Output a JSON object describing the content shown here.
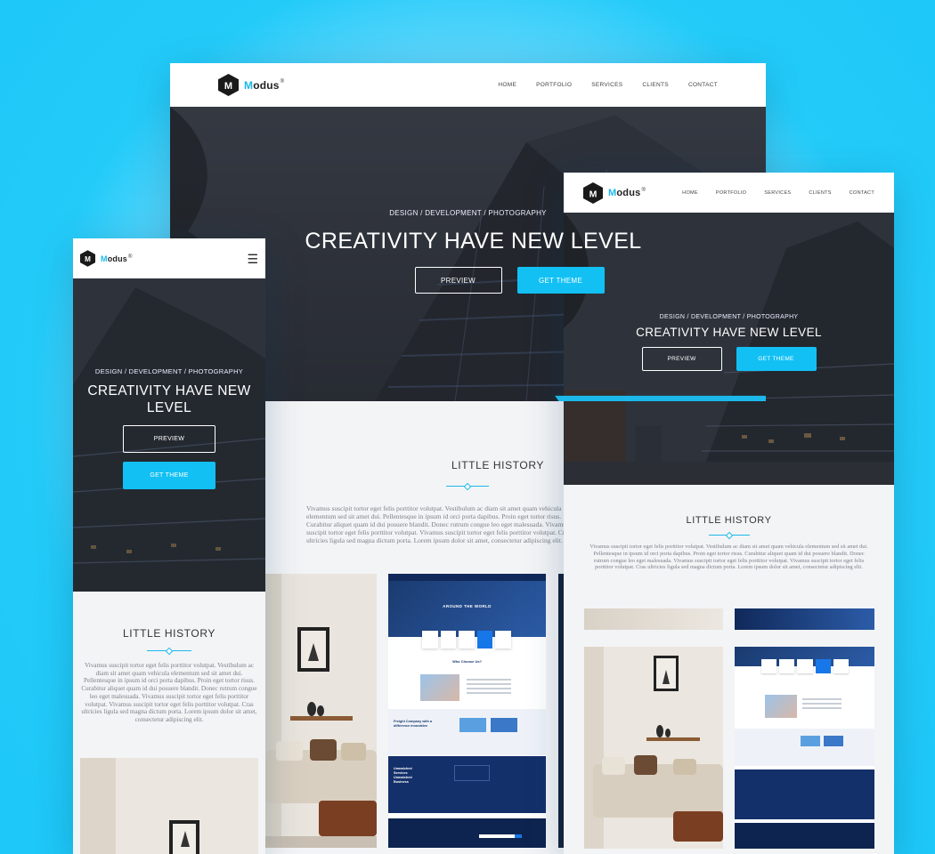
{
  "brand": {
    "name_first": "M",
    "name_rest": "odus",
    "mark": "®",
    "monogram": "M"
  },
  "nav": {
    "items": [
      "HOME",
      "PORTFOLIO",
      "SERVICES",
      "CLIENTS",
      "CONTACT"
    ],
    "menu_icon": "hamburger-icon"
  },
  "hero": {
    "eyebrow": "DESIGN / DEVELOPMENT / PHOTOGRAPHY",
    "headline": "CREATIVITY HAVE NEW LEVEL",
    "headline_mobile_line1": "CREATIVITY HAVE NEW",
    "headline_mobile_line2": "LEVEL",
    "preview_label": "PREVIEW",
    "get_theme_label": "GET THEME",
    "scroll_icon": "chevron-down-icon"
  },
  "history": {
    "title": "LITTLE HISTORY",
    "body": "Vivamus suscipit tortor eget felis porttitor volutpat. Vestibulum ac diam sit amet quam vehicula elementum sed sit amet dui. Pellentesque in ipsum id orci porta dapibus. Proin eget tortor risus. Curabitur aliquet quam id dui posuere blandit. Donec rutrum congue leo eget malesuada. Vivamus suscipit tortor eget felis porttitor volutpat. Vivamus suscipit tortor eget felis porttitor volutpat. Cras ultricies ligula sed magna dictum porta. Lorem ipsum dolor sit amet, consectetur adipiscing elit."
  },
  "preview_site": {
    "hero_caption": "AROUND THE WORLD",
    "subhead": "Who Choose Us?",
    "feature1": "Freight Company with a difference innovative",
    "feature2": "Unmatched Services Unmatched Business"
  },
  "colors": {
    "accent": "#12c0f4",
    "background": "#1ec8f8",
    "dark_navy": "#102a52"
  }
}
